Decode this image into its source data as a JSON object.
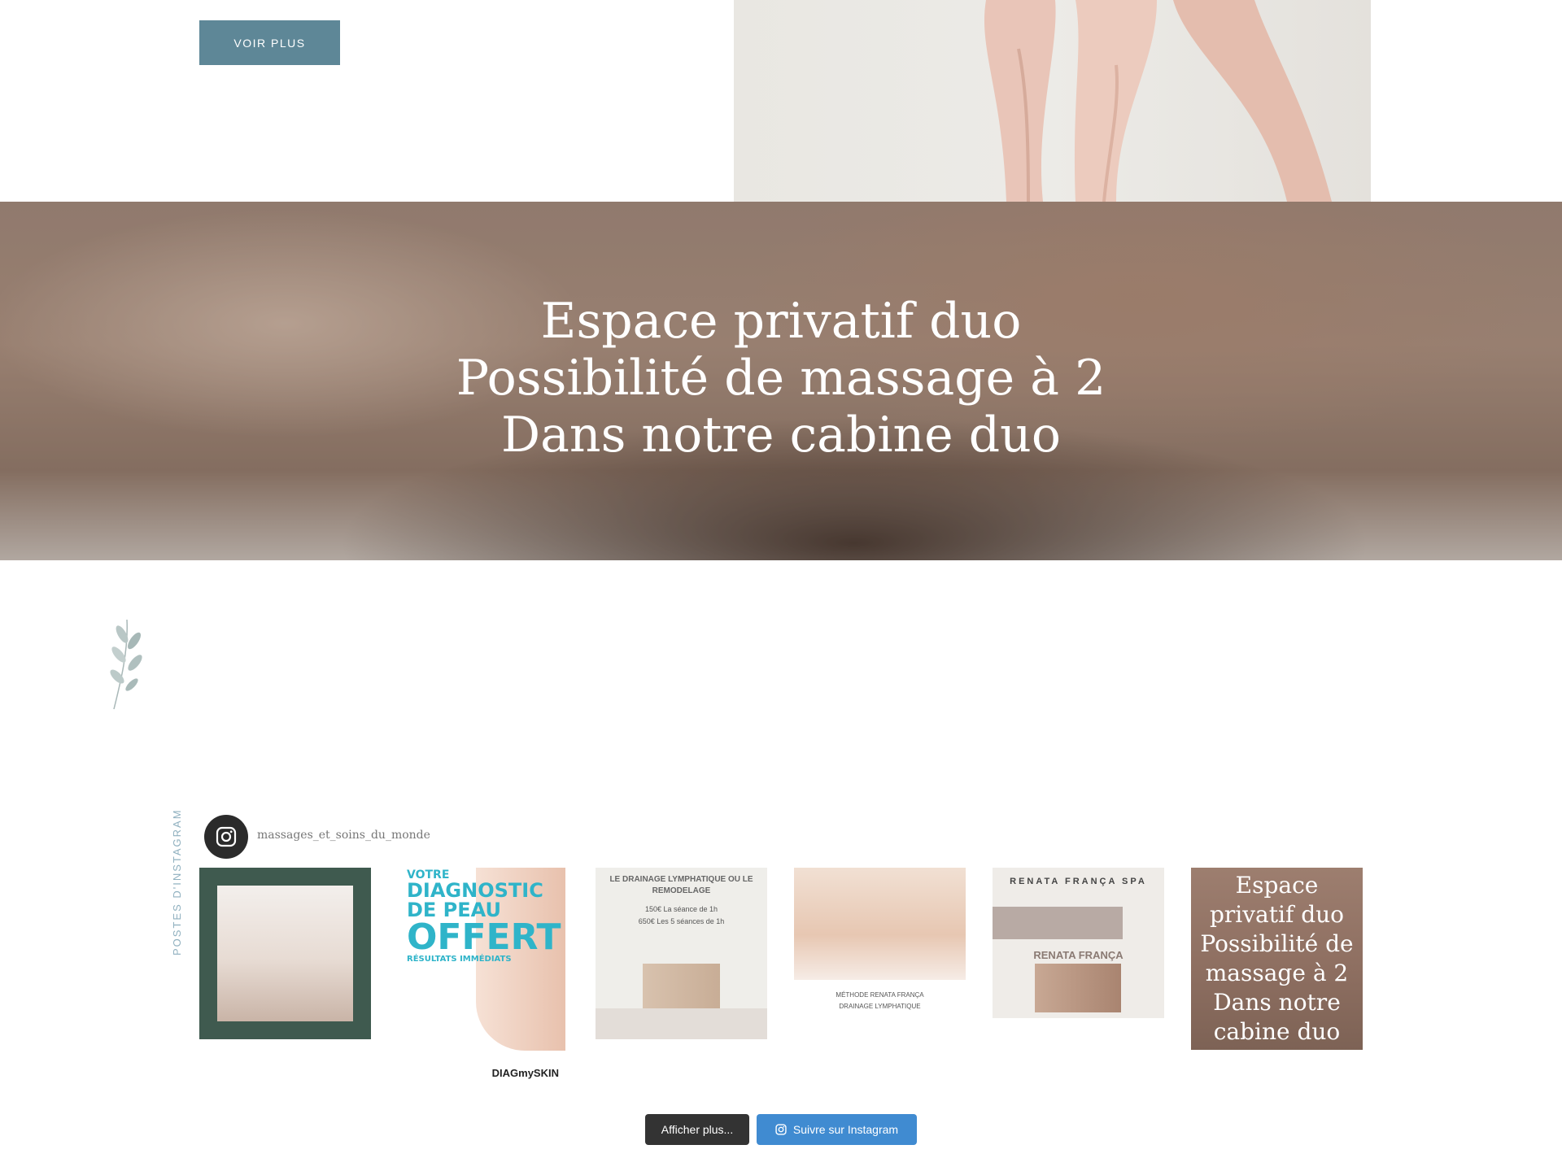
{
  "top_section": {
    "voir_plus_label": "VOIR PLUS"
  },
  "hero": {
    "title": "Espace privatif duo Possibilité de massage à 2 Dans notre cabine duo"
  },
  "instagram": {
    "side_label": "POSTES D'INSTAGRAM",
    "username": "massages_et_soins_du_monde",
    "posts": {
      "p2": {
        "line1": "VOTRE",
        "line2": "DIAGNOSTIC",
        "line3": "DE PEAU",
        "line4": "OFFERT",
        "line5": "RÉSULTATS IMMÉDIATS",
        "brand": "DIAGmySKIN"
      },
      "p3": {
        "title": "LE DRAINAGE LYMPHATIQUE OU LE REMODELAGE",
        "price1": "150€ La séance de 1h",
        "price2": "650€ Les 5 séances de 1h"
      },
      "p4": {
        "caption1": "MÉTHODE RENATA FRANÇA",
        "caption2": "DRAINAGE LYMPHATIQUE"
      },
      "p5": {
        "head": "RENATA FRANÇA SPA",
        "name": "RENATA FRANÇA"
      },
      "p6": {
        "text": "Espace privatif duo Possibilité de massage à 2 Dans notre cabine duo"
      }
    },
    "load_more_label": "Afficher plus...",
    "follow_label": "Suivre sur Instagram"
  },
  "colors": {
    "button_teal": "#5e8797",
    "follow_blue": "#408bd1",
    "load_more_dark": "#333333"
  },
  "icons": {
    "avatar": "instagram-icon",
    "follow": "instagram-icon",
    "decor": "leaf-icon"
  }
}
